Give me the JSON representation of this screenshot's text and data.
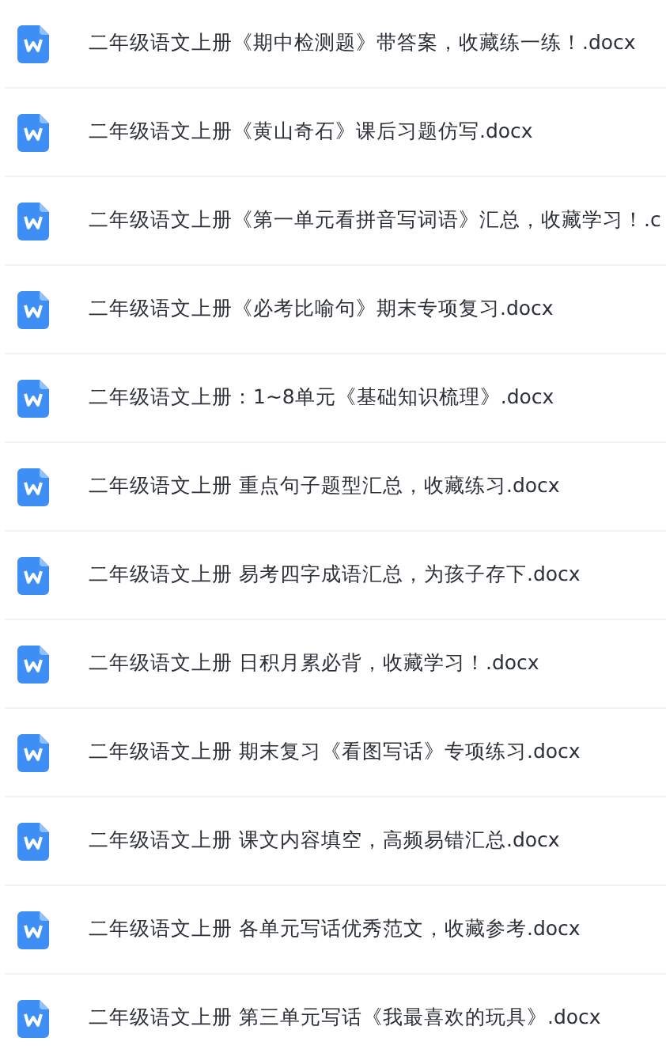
{
  "files": [
    {
      "name": "二年级语文上册《期中检测题》带答案，收藏练一练！.docx"
    },
    {
      "name": "二年级语文上册《黄山奇石》课后习题仿写.docx"
    },
    {
      "name": "二年级语文上册《第一单元看拼音写词语》汇总，收藏学习！.c"
    },
    {
      "name": "二年级语文上册《必考比喻句》期末专项复习.docx"
    },
    {
      "name": "二年级语文上册：1~8单元《基础知识梳理》.docx"
    },
    {
      "name": "二年级语文上册 重点句子题型汇总，收藏练习.docx"
    },
    {
      "name": "二年级语文上册 易考四字成语汇总，为孩子存下.docx"
    },
    {
      "name": "二年级语文上册 日积月累必背，收藏学习！.docx"
    },
    {
      "name": "二年级语文上册 期末复习《看图写话》专项练习.docx"
    },
    {
      "name": "二年级语文上册 课文内容填空，高频易错汇总.docx"
    },
    {
      "name": "二年级语文上册 各单元写话优秀范文，收藏参考.docx"
    },
    {
      "name": "二年级语文上册 第三单元写话《我最喜欢的玩具》.docx"
    }
  ]
}
